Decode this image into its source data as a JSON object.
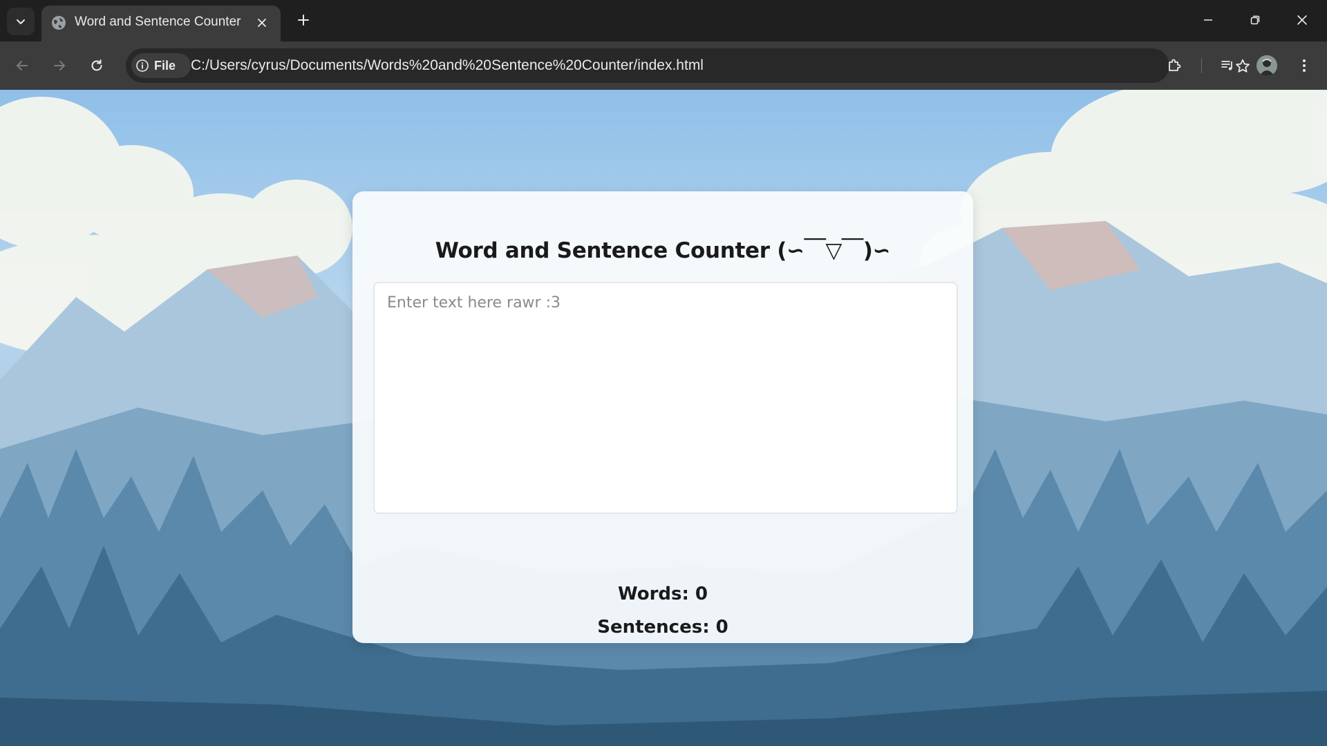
{
  "browser": {
    "tab": {
      "title": "Word and Sentence Counter"
    },
    "address_bar": {
      "chip_label": "File",
      "url": "C:/Users/cyrus/Documents/Words%20and%20Sentence%20Counter/index.html"
    },
    "icons": {
      "tab_search": "chevron-down-icon",
      "favicon": "globe-icon",
      "tab_close": "close-icon",
      "new_tab": "plus-icon",
      "minimize": "minimize-icon",
      "restore": "restore-icon",
      "close_window": "close-icon",
      "back": "arrow-left-icon",
      "forward": "arrow-right-icon",
      "reload": "reload-icon",
      "info": "info-icon",
      "bookmark": "star-icon",
      "extensions": "puzzle-icon",
      "media": "media-control-icon",
      "profile": "avatar",
      "menu": "kebab-menu-icon"
    }
  },
  "page": {
    "title": "Word and Sentence Counter (∽￣▽￣)∽",
    "input": {
      "placeholder": "Enter text here rawr :3",
      "value": ""
    },
    "stats": {
      "words_text": "Words: 0",
      "sentences_text": "Sentences: 0"
    }
  },
  "colors": {
    "chrome_dark": "#1f1f1f",
    "toolbar": "#3c3c3c",
    "omnibox": "#282828",
    "card_bg": "#fafcfd",
    "text": "#1a1a1a"
  }
}
